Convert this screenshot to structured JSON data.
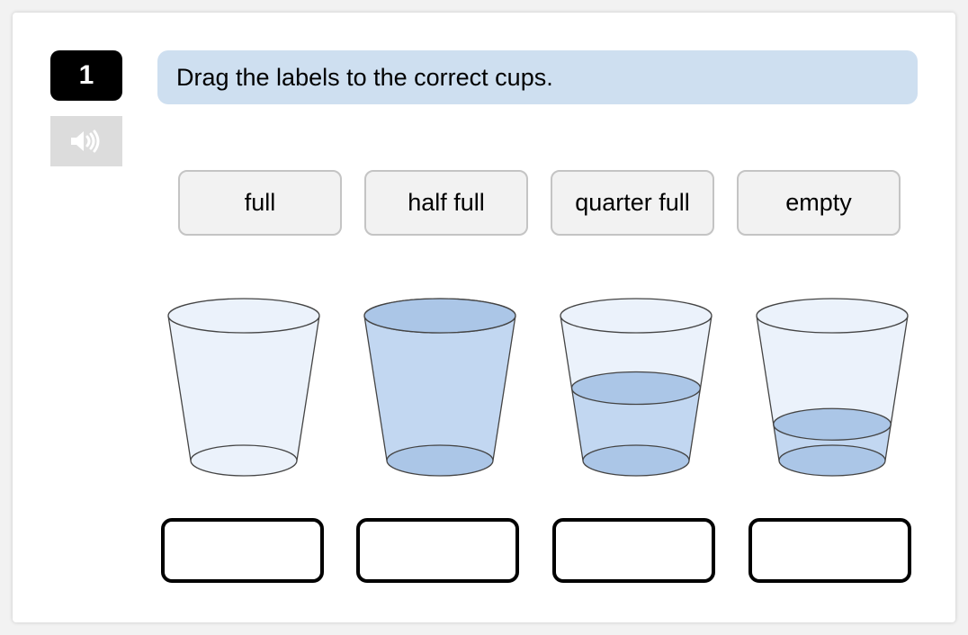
{
  "question": {
    "number": "1",
    "instruction": "Drag the labels to the correct cups."
  },
  "audio_button": {
    "icon": "speaker-icon"
  },
  "labels": [
    {
      "text": "full"
    },
    {
      "text": "half full"
    },
    {
      "text": "quarter full"
    },
    {
      "text": "empty"
    }
  ],
  "cups": [
    {
      "water_fill": 0.0
    },
    {
      "water_fill": 1.0
    },
    {
      "water_fill": 0.5
    },
    {
      "water_fill": 0.25
    }
  ],
  "drop_zones": [
    {
      "value": ""
    },
    {
      "value": ""
    },
    {
      "value": ""
    },
    {
      "value": ""
    }
  ],
  "colors": {
    "instruction_bg": "#cedff0",
    "cup_glass": "#ebf2fb",
    "water": "#c2d7f1",
    "water_surface": "#abc6e7",
    "outline": "#444444"
  }
}
